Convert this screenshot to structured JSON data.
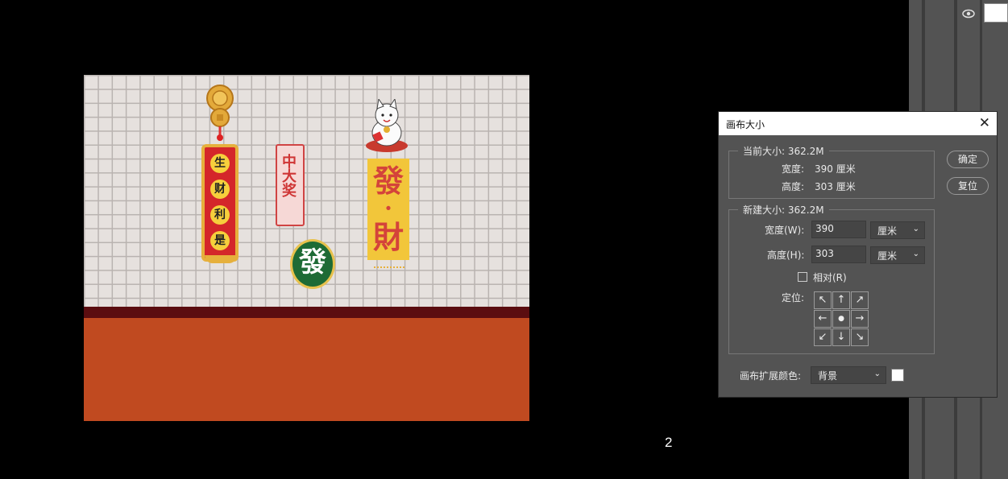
{
  "canvas_art": {
    "vertical_couplet": [
      "生",
      "财",
      "利",
      "是"
    ],
    "small_sign": "中大奖",
    "tile_char": "發",
    "gold_banner_top": "發",
    "gold_banner_dot": "·",
    "gold_banner_bottom": "財"
  },
  "page_number": "2",
  "dialog": {
    "title": "画布大小",
    "close_glyph": "✕",
    "current_size": {
      "legend": "当前大小: 362.2M",
      "width_label": "宽度:",
      "width_value": "390 厘米",
      "height_label": "高度:",
      "height_value": "303 厘米"
    },
    "new_size": {
      "legend": "新建大小: 362.2M",
      "width_label": "宽度(W):",
      "width_value": "390",
      "width_unit": "厘米",
      "height_label": "高度(H):",
      "height_value": "303",
      "height_unit": "厘米",
      "relative_label": "相对(R)",
      "relative_checked": false,
      "anchor_label": "定位:",
      "anchor_arrows": [
        "↖",
        "↑",
        "↗",
        "←",
        "●",
        "→",
        "↙",
        "↓",
        "↘"
      ]
    },
    "extension_color_label": "画布扩展颜色:",
    "extension_color_value": "背景",
    "extension_color_swatch": "#ffffff",
    "ok_label": "确定",
    "reset_label": "复位"
  },
  "layers_panel": {
    "visibility_icon": "eye-icon"
  }
}
